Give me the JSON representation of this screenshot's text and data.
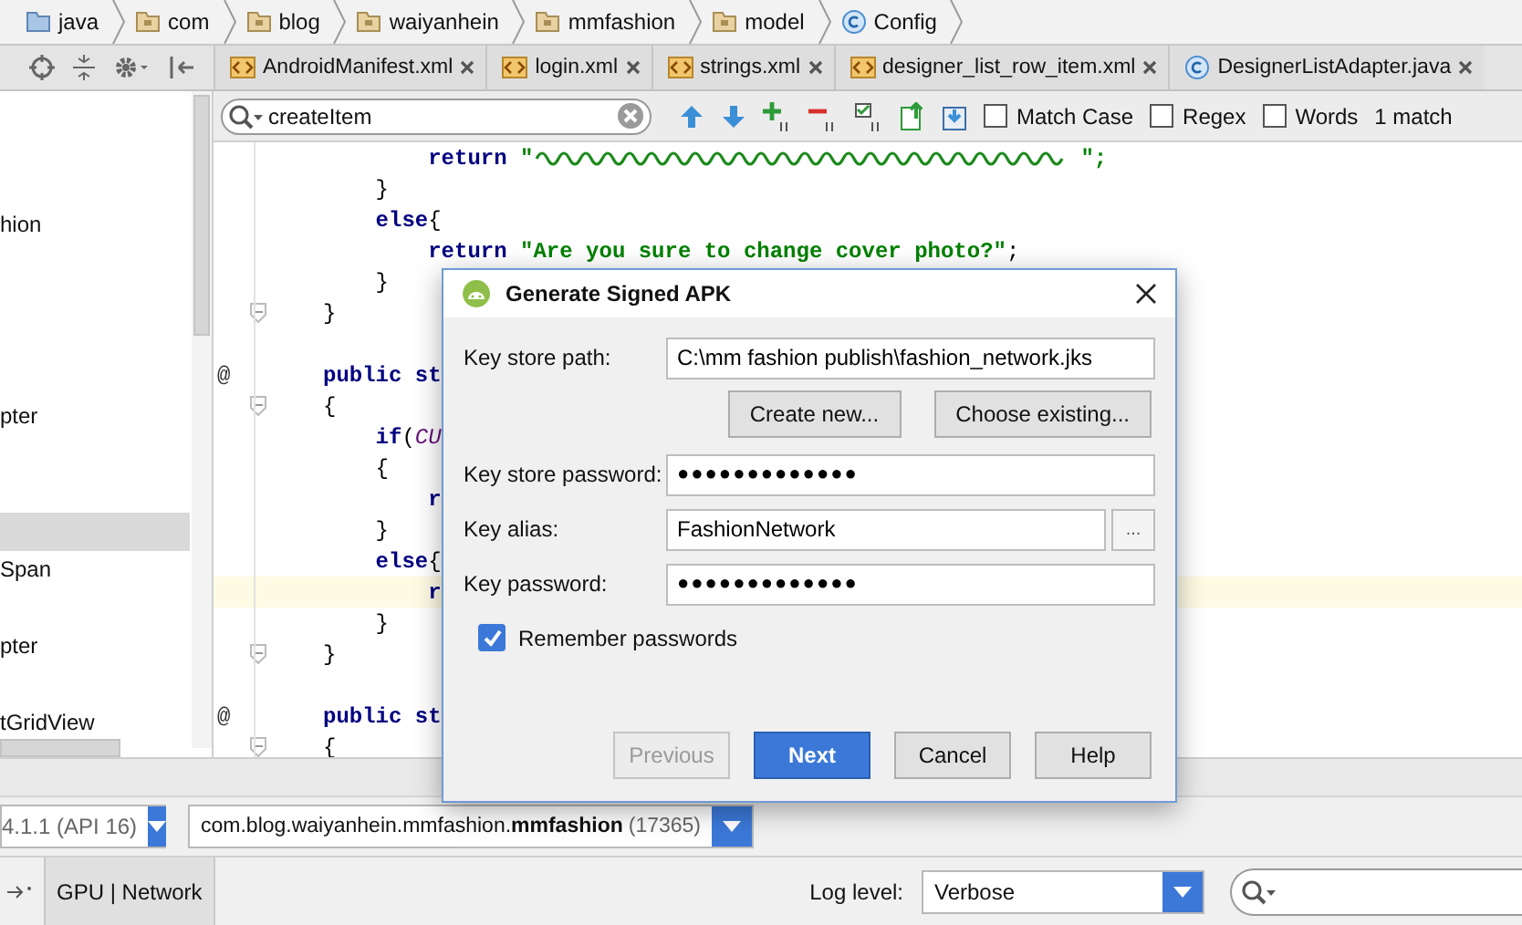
{
  "breadcrumbs": [
    {
      "label": "java",
      "kind": "source-folder"
    },
    {
      "label": "com",
      "kind": "package"
    },
    {
      "label": "blog",
      "kind": "package"
    },
    {
      "label": "waiyanhein",
      "kind": "package"
    },
    {
      "label": "mmfashion",
      "kind": "package"
    },
    {
      "label": "model",
      "kind": "package"
    },
    {
      "label": "Config",
      "kind": "class"
    }
  ],
  "editor_tabs": [
    {
      "label": "AndroidManifest.xml",
      "kind": "xml"
    },
    {
      "label": "login.xml",
      "kind": "xml"
    },
    {
      "label": "strings.xml",
      "kind": "xml"
    },
    {
      "label": "designer_list_row_item.xml",
      "kind": "xml"
    },
    {
      "label": "DesignerListAdapter.java",
      "kind": "class"
    }
  ],
  "project_rows": [
    {
      "selected": false
    },
    {
      "selected": false
    },
    {
      "selected": false
    },
    {
      "label": "hion",
      "selected": false
    },
    {
      "selected": false
    },
    {
      "selected": false
    },
    {
      "selected": false
    },
    {
      "selected": false
    },
    {
      "label": "pter",
      "selected": false
    },
    {
      "selected": false
    },
    {
      "selected": false
    },
    {
      "selected": true
    },
    {
      "label": "Span",
      "selected": false
    },
    {
      "selected": false
    },
    {
      "label": "pter",
      "selected": false
    },
    {
      "selected": false
    },
    {
      "label": "tGridView",
      "selected": false
    }
  ],
  "find_bar": {
    "query": "createItem",
    "options": [
      {
        "label": "Match Case",
        "checked": false
      },
      {
        "label": "Regex",
        "checked": false
      },
      {
        "label": "Words",
        "checked": false
      }
    ],
    "result": "1 match"
  },
  "code_lines": [
    {
      "segments": [
        {
          "kind": "keyword",
          "text": "        return "
        },
        {
          "kind": "string",
          "text": "\""
        },
        {
          "kind": "unreadable"
        },
        {
          "kind": "string",
          "text": "\";"
        }
      ]
    },
    {
      "segments": [
        {
          "kind": "plain",
          "text": "    }"
        }
      ]
    },
    {
      "segments": [
        {
          "kind": "keyword",
          "text": "    else"
        },
        {
          "kind": "plain",
          "text": "{"
        }
      ]
    },
    {
      "segments": [
        {
          "kind": "keyword",
          "text": "        return "
        },
        {
          "kind": "string",
          "text": "\"Are you sure to change cover photo?\""
        },
        {
          "kind": "plain",
          "text": ";"
        }
      ]
    },
    {
      "segments": [
        {
          "kind": "plain",
          "text": "    }"
        }
      ]
    },
    {
      "fold": true,
      "segments": [
        {
          "kind": "plain",
          "text": "}"
        }
      ]
    },
    {
      "blank": true
    },
    {
      "gutter": "@",
      "segments": [
        {
          "kind": "keyword",
          "text": "public st"
        }
      ]
    },
    {
      "fold": true,
      "segments": [
        {
          "kind": "plain",
          "text": "{"
        }
      ]
    },
    {
      "segments": [
        {
          "kind": "keyword",
          "text": "    if"
        },
        {
          "kind": "plain",
          "text": "("
        },
        {
          "kind": "field",
          "text": "CU"
        }
      ]
    },
    {
      "segments": [
        {
          "kind": "plain",
          "text": "    {"
        }
      ]
    },
    {
      "segments": [
        {
          "kind": "keyword",
          "text": "        r"
        }
      ]
    },
    {
      "segments": [
        {
          "kind": "plain",
          "text": "    }"
        }
      ]
    },
    {
      "segments": [
        {
          "kind": "keyword",
          "text": "    else"
        },
        {
          "kind": "plain",
          "text": "{"
        }
      ]
    },
    {
      "current": true,
      "segments": [
        {
          "kind": "keyword",
          "text": "        r"
        }
      ]
    },
    {
      "segments": [
        {
          "kind": "plain",
          "text": "    }"
        }
      ]
    },
    {
      "fold": true,
      "segments": [
        {
          "kind": "plain",
          "text": "}"
        }
      ]
    },
    {
      "blank": true
    },
    {
      "gutter": "@",
      "segments": [
        {
          "kind": "keyword",
          "text": "public st"
        }
      ]
    },
    {
      "fold": true,
      "segments": [
        {
          "kind": "plain",
          "text": "{"
        }
      ]
    }
  ],
  "dialog": {
    "title": "Generate Signed APK",
    "fields": [
      {
        "kind": "text",
        "label": "Key store path:",
        "value": "C:\\mm fashion publish\\fashion_network.jks"
      },
      {
        "kind": "actions",
        "buttons": [
          "Create new...",
          "Choose existing..."
        ]
      },
      {
        "kind": "password",
        "label": "Key store password:",
        "value": "●●●●●●●●●●●●●"
      },
      {
        "kind": "browse",
        "label": "Key alias:",
        "value": "FashionNetwork",
        "button": "..."
      },
      {
        "kind": "password",
        "label": "Key password:",
        "value": "●●●●●●●●●●●●●"
      }
    ],
    "remember": {
      "label": "Remember passwords",
      "checked": true
    },
    "buttons": [
      {
        "label": "Previous",
        "kind": "default",
        "disabled": true
      },
      {
        "label": "Next",
        "kind": "primary",
        "disabled": false
      },
      {
        "label": "Cancel",
        "kind": "default",
        "disabled": false
      },
      {
        "label": "Help",
        "kind": "default",
        "disabled": false
      }
    ]
  },
  "device_bar": {
    "device": "4.1.1 (API 16)",
    "process": "com.blog.waiyanhein.mmfashion.**mmfashion**",
    "pid": "(17365)"
  },
  "logcat_bar": {
    "tab": "GPU | Network",
    "log_level_label": "Log level:",
    "log_level": "Verbose"
  }
}
